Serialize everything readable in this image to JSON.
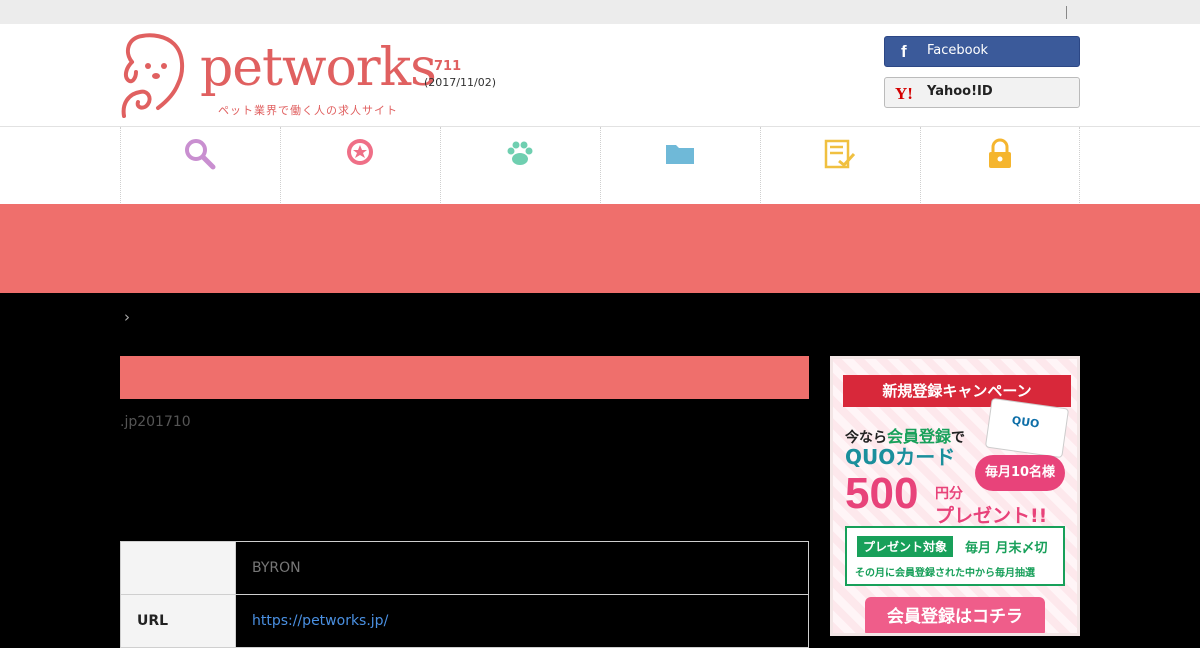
{
  "site": {
    "brand": "petworks",
    "tagline": "ペット業界で働く人の求人サイト",
    "member_count": "711",
    "count_date": "(2017/11/02)"
  },
  "login": {
    "facebook_label": "Facebook",
    "facebook_icon": "f",
    "yahoo_label": "Yahoo!ID",
    "yahoo_icon": "Y!"
  },
  "nav": {
    "items": [
      {
        "icon": "search-icon",
        "color": "#c98fd0"
      },
      {
        "icon": "badge-star-icon",
        "color": "#ef6f87"
      },
      {
        "icon": "paw-icon",
        "color": "#6fcfb0"
      },
      {
        "icon": "folder-icon",
        "color": "#6fb9d8"
      },
      {
        "icon": "checklist-icon",
        "color": "#f0c040"
      },
      {
        "icon": "lock-icon",
        "color": "#f5b52e"
      }
    ]
  },
  "breadcrumb": {
    "separator": "›"
  },
  "content": {
    "mail_text": ".jp201710",
    "table": [
      {
        "label": "",
        "value": "BYRON"
      },
      {
        "label": "URL",
        "value": "https://petworks.jp/"
      }
    ]
  },
  "ad": {
    "ribbon": "新規登録キャンペーン",
    "card_text": "QUO",
    "line1_prefix": "今なら",
    "line1_em": "会員登録",
    "line1_suffix": "で",
    "line2": "QUOカード",
    "badge": "毎月10名様",
    "amount": "500",
    "amount_unit": "円分",
    "present": "プレゼント!!",
    "target_pill": "プレゼント対象",
    "target_when": "毎月 月末〆切",
    "target_note": "その月に会員登録された中から毎月抽選",
    "cta": "会員登録はコチラ"
  },
  "colors": {
    "accent": "#ef6f6c",
    "facebook": "#3b5a9a",
    "link": "#4a90e2"
  }
}
